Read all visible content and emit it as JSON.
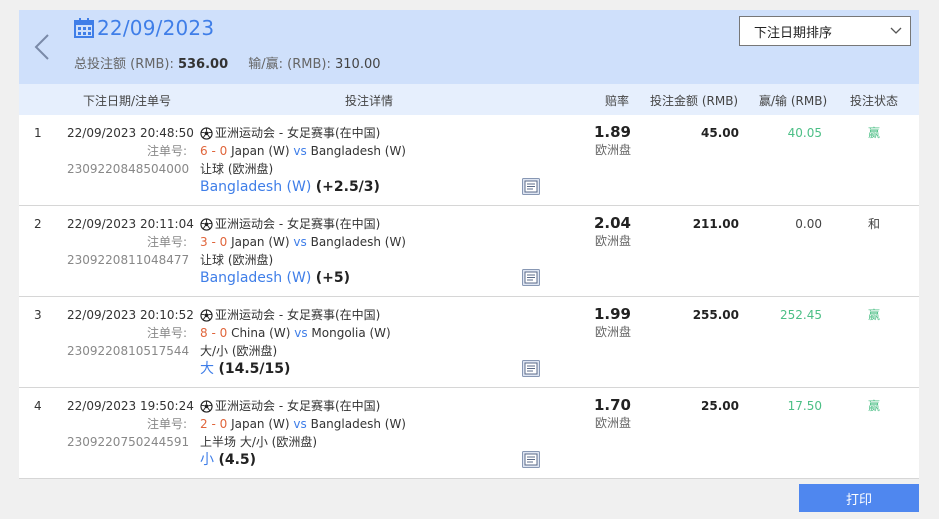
{
  "header": {
    "date": "22/09/2023",
    "total_label": "总投注额 (RMB):",
    "total_value": "536.00",
    "winloss_label": "输/赢: (RMB):",
    "winloss_value": "310.00",
    "sort_selected": "下注日期排序"
  },
  "columns": {
    "datetime": "下注日期/注单号",
    "detail": "投注详情",
    "odds": "赔率",
    "stake": "投注金额 (RMB)",
    "winloss": "赢/输 (RMB)",
    "status": "投注状态"
  },
  "rows": [
    {
      "index": "1",
      "datetime": "22/09/2023 20:48:50",
      "ticket_label": "注单号:",
      "ticket_no": "2309220848504000",
      "league": "亚洲运动会 - 女足赛事(在中国)",
      "score": "6 - 0",
      "home": "Japan (W)",
      "vs": "vs",
      "away": "Bangladesh (W)",
      "market": "让球 (欧洲盘)",
      "selection": "Bangladesh (W)",
      "handicap": "(+2.5/3)",
      "odds": "1.89",
      "odds_market": "欧洲盘",
      "stake": "45.00",
      "winloss": "40.05",
      "status": "赢"
    },
    {
      "index": "2",
      "datetime": "22/09/2023 20:11:04",
      "ticket_label": "注单号:",
      "ticket_no": "2309220811048477",
      "league": "亚洲运动会 - 女足赛事(在中国)",
      "score": "3 - 0",
      "home": "Japan (W)",
      "vs": "vs",
      "away": "Bangladesh (W)",
      "market": "让球 (欧洲盘)",
      "selection": "Bangladesh (W)",
      "handicap": "(+5)",
      "odds": "2.04",
      "odds_market": "欧洲盘",
      "stake": "211.00",
      "winloss": "0.00",
      "status": "和"
    },
    {
      "index": "3",
      "datetime": "22/09/2023 20:10:52",
      "ticket_label": "注单号:",
      "ticket_no": "2309220810517544",
      "league": "亚洲运动会 - 女足赛事(在中国)",
      "score": "8 - 0",
      "home": "China (W)",
      "vs": "vs",
      "away": "Mongolia (W)",
      "market": "大/小 (欧洲盘)",
      "selection": "大",
      "handicap": "(14.5/15)",
      "odds": "1.99",
      "odds_market": "欧洲盘",
      "stake": "255.00",
      "winloss": "252.45",
      "status": "赢"
    },
    {
      "index": "4",
      "datetime": "22/09/2023 19:50:24",
      "ticket_label": "注单号:",
      "ticket_no": "2309220750244591",
      "league": "亚洲运动会 - 女足赛事(在中国)",
      "score": "2 - 0",
      "home": "Japan (W)",
      "vs": "vs",
      "away": "Bangladesh (W)",
      "market": "上半场 大/小 (欧洲盘)",
      "selection": "小",
      "handicap": "(4.5)",
      "odds": "1.70",
      "odds_market": "欧洲盘",
      "stake": "25.00",
      "winloss": "17.50",
      "status": "赢"
    }
  ],
  "footer": {
    "print_label": "打印"
  },
  "icons": {
    "back": "chevron-left-icon",
    "calendar": "calendar-icon",
    "sort": "chevron-down-icon",
    "sport": "soccer-ball-icon",
    "detail": "document-icon"
  },
  "colors": {
    "accent": "#3f7ee8",
    "score": "#e0653b",
    "win": "#4cbf86",
    "header_bg": "#cfe0fb",
    "print_button": "#4f87ef"
  }
}
